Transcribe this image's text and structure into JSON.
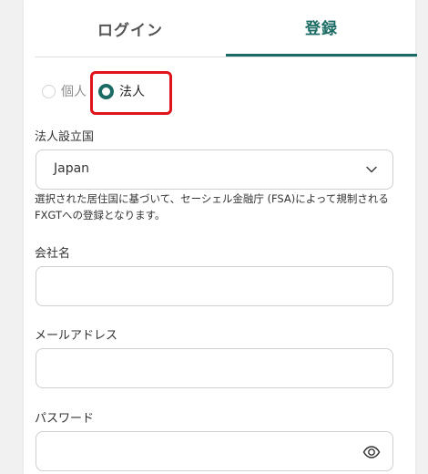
{
  "tabs": {
    "login": "ログイン",
    "register": "登録"
  },
  "account_type": {
    "individual": "個人",
    "corporate": "法人",
    "selected": "corporate"
  },
  "country_field": {
    "label": "法人設立国",
    "value": "Japan",
    "note": "選択された居住国に基づいて、セーシェル金融庁 (FSA)によって規制されるFXGTへの登録となります。"
  },
  "company_field": {
    "label": "会社名",
    "value": ""
  },
  "email_field": {
    "label": "メールアドレス",
    "value": ""
  },
  "password_field": {
    "label": "パスワード",
    "value": ""
  },
  "colors": {
    "accent": "#1a6b63",
    "highlight": "#e0121b"
  },
  "icons": {
    "select": "chevron-down-icon",
    "password": "eye-icon"
  }
}
